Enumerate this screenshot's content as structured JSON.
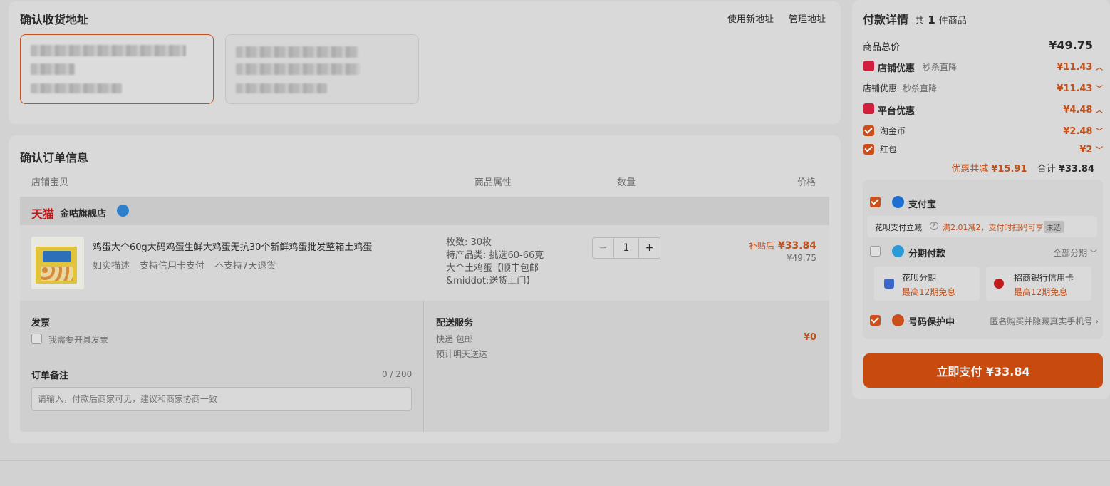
{
  "address": {
    "title": "确认收货地址",
    "new_address": "使用新地址",
    "manage_address": "管理地址"
  },
  "order": {
    "title": "确认订单信息",
    "columns": {
      "shop_item": "店铺宝贝",
      "attributes": "商品属性",
      "quantity": "数量",
      "price": "价格"
    },
    "shop": {
      "platform": "天猫",
      "name": "金咕旗舰店"
    },
    "product": {
      "title": "鸡蛋大个60g大码鸡蛋生鲜大鸡蛋无抗30个新鲜鸡蛋批发整箱土鸡蛋",
      "tags": [
        "如实描述",
        "支持信用卡支付",
        "不支持7天退货"
      ],
      "attrs": [
        "枚数: 30枚",
        "特产品类: 挑选60-66克",
        "大个土鸡蛋【顺丰包邮",
        "&middot;送货上门】"
      ],
      "quantity": "1",
      "minus": "−",
      "plus": "+",
      "subsidy_label": "补贴后",
      "subsidy_price": "¥33.84",
      "original_price": "¥49.75"
    },
    "invoice": {
      "title": "发票",
      "option": "我需要开具发票"
    },
    "note": {
      "title": "订单备注",
      "count": "0 / 200",
      "placeholder": "请输入，付款后商家可见，建议和商家协商一致"
    },
    "delivery": {
      "title": "配送服务",
      "method": "快递 包邮",
      "fee": "¥0",
      "eta": "预计明天送达"
    }
  },
  "payment": {
    "title": "付款详情",
    "count_prefix": "共",
    "count": "1",
    "count_suffix": "件商品",
    "total_label": "商品总价",
    "total_value": "¥49.75",
    "shop_discount_label": "店铺优惠",
    "shop_discount_note": "秒杀直降",
    "shop_discount_value": "¥11.43",
    "shop_sub_label": "店铺优惠",
    "shop_sub_note": "秒杀直降",
    "shop_sub_value": "¥11.43",
    "platform_label": "平台优惠",
    "platform_value": "¥4.48",
    "coin_label": "淘金币",
    "coin_value": "¥2.48",
    "redpacket_label": "红包",
    "redpacket_value": "¥2",
    "saved_label": "优惠共减",
    "saved_value": "¥15.91",
    "sum_label": "合计",
    "sum_value": "¥33.84",
    "alipay_label": "支付宝",
    "huabei_promo_label": "花呗支付立减",
    "huabei_promo_text": "满2.01减2，支付时扫码可享",
    "huabei_promo_badge": "未选",
    "installment_label": "分期付款",
    "installment_all": "全部分期",
    "huabei_title": "花呗分期",
    "huabei_sub": "最高12期免息",
    "cmb_title": "招商银行信用卡",
    "cmb_sub": "最高12期免息",
    "privacy_label": "号码保护中",
    "privacy_text": "匿名购买并隐藏真实手机号",
    "pay_button": "立即支付 ¥33.84"
  }
}
